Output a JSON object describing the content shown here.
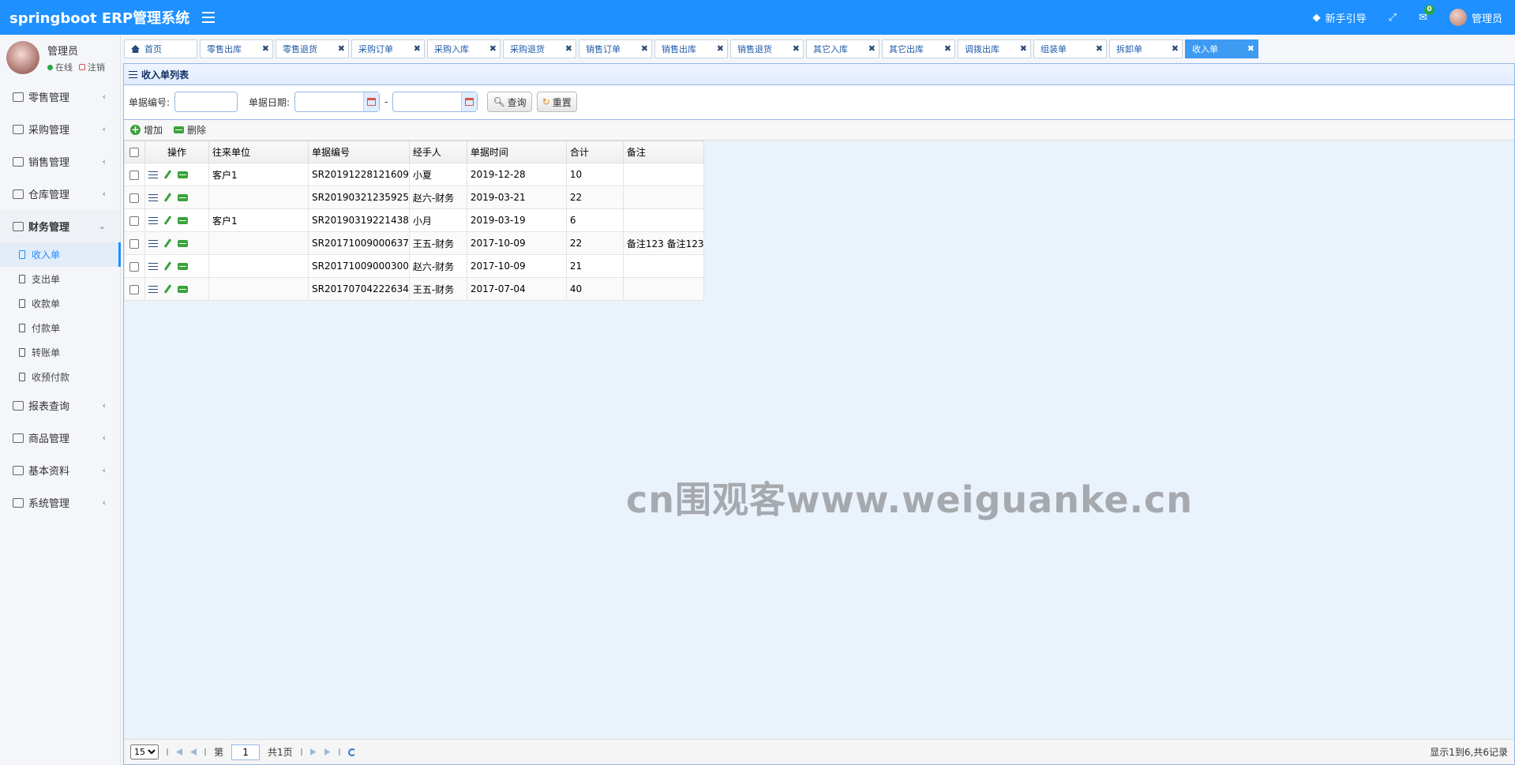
{
  "header": {
    "title": "springboot ERP管理系统",
    "guide": "新手引导",
    "mail_count": "0",
    "user": "管理员"
  },
  "sidebar": {
    "user_name": "管理员",
    "status": "在线",
    "logout": "注销",
    "menus": [
      "零售管理",
      "采购管理",
      "销售管理",
      "仓库管理",
      "财务管理",
      "报表查询",
      "商品管理",
      "基本资料",
      "系统管理"
    ],
    "finance_items": [
      "收入单",
      "支出单",
      "收款单",
      "付款单",
      "转账单",
      "收预付款"
    ]
  },
  "tabs": [
    "首页",
    "零售出库",
    "零售退货",
    "采购订单",
    "采购入库",
    "采购退货",
    "销售订单",
    "销售出库",
    "销售退货",
    "其它入库",
    "其它出库",
    "调拨出库",
    "组装单",
    "拆卸单",
    "收入单"
  ],
  "panel": {
    "title": "收入单列表",
    "search": {
      "number_label": "单据编号:",
      "date_label": "单据日期:",
      "sep": "-",
      "query": "查询",
      "reset": "重置"
    },
    "toolbar": {
      "add": "增加",
      "delete": "删除"
    },
    "columns": [
      "操作",
      "往来单位",
      "单据编号",
      "经手人",
      "单据时间",
      "合计",
      "备注"
    ],
    "rows": [
      [
        "客户1",
        "SR20191228121609",
        "小夏",
        "2019-12-28",
        "10",
        ""
      ],
      [
        "",
        "SR20190321235925",
        "赵六-财务",
        "2019-03-21",
        "22",
        ""
      ],
      [
        "客户1",
        "SR20190319221438",
        "小月",
        "2019-03-19",
        "6",
        ""
      ],
      [
        "",
        "SR20171009000637",
        "王五-财务",
        "2017-10-09",
        "22",
        "备注123 备注123"
      ],
      [
        "",
        "SR20171009000300",
        "赵六-财务",
        "2017-10-09",
        "21",
        ""
      ],
      [
        "",
        "SR20170704222634",
        "王五-财务",
        "2017-07-04",
        "40",
        ""
      ]
    ],
    "watermark": "cn围观客www.weiguanke.cn",
    "pager": {
      "page_size": "15",
      "page_prefix": "第",
      "page": "1",
      "page_total": "共1页",
      "info": "显示1到6,共6记录"
    }
  }
}
